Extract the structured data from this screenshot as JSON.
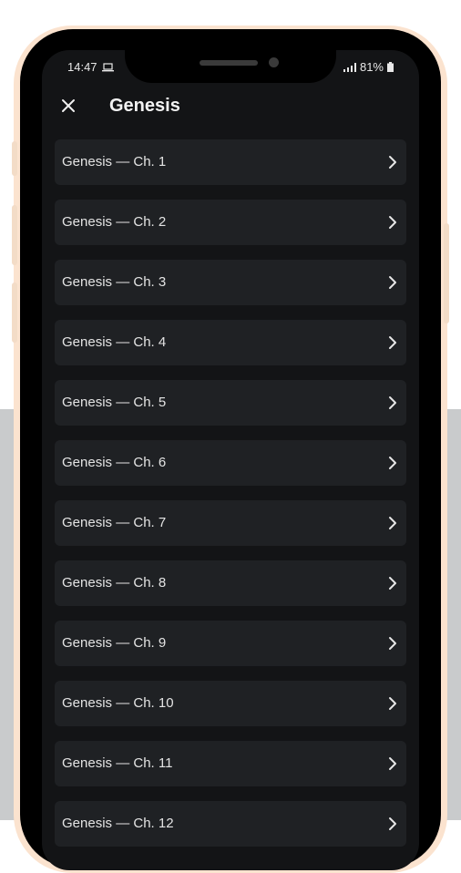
{
  "status_bar": {
    "time": "14:47",
    "battery": "81%"
  },
  "header": {
    "title": "Genesis"
  },
  "chapters": [
    "Genesis — Ch. 1",
    "Genesis — Ch. 2",
    "Genesis — Ch. 3",
    "Genesis — Ch. 4",
    "Genesis — Ch. 5",
    "Genesis — Ch. 6",
    "Genesis — Ch. 7",
    "Genesis — Ch. 8",
    "Genesis — Ch. 9",
    "Genesis — Ch. 10",
    "Genesis — Ch. 11",
    "Genesis — Ch. 12"
  ],
  "icons": {
    "close": "close-icon",
    "chevron": "chevron-right-icon",
    "laptop": "laptop-icon",
    "signal": "signal-icon",
    "battery": "battery-icon"
  },
  "colors": {
    "screen_bg": "#131416",
    "row_bg": "#1f2124",
    "frame": "#fbe3cf",
    "lower_bg": "#c9cbcc"
  }
}
